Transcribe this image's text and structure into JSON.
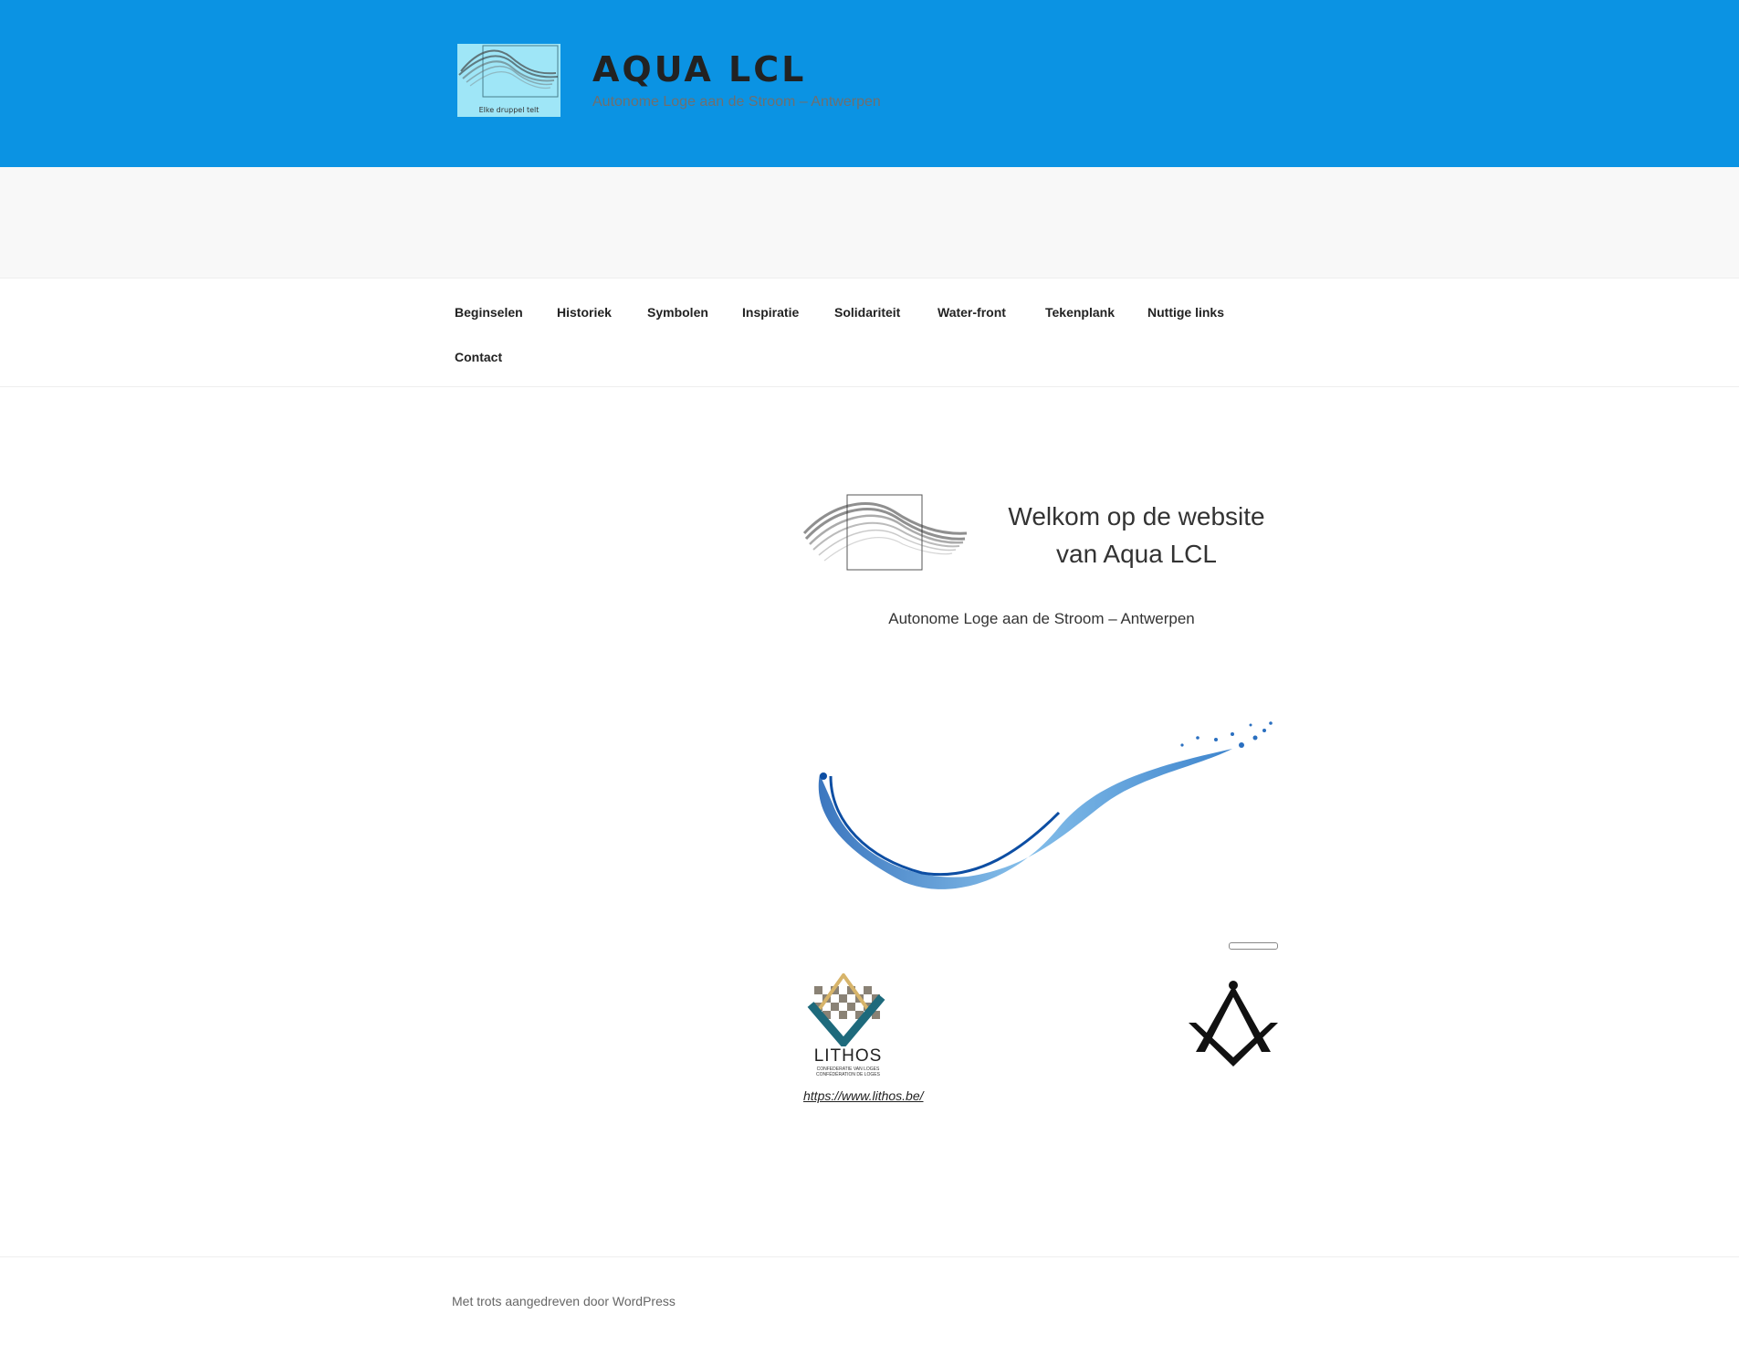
{
  "header": {
    "title": "AQUA LCL",
    "tagline": "Autonome Loge aan de Stroom – Antwerpen",
    "logo_caption": "Elke druppel telt",
    "background_color": "#0b93e3"
  },
  "nav": {
    "items": [
      {
        "label": "Beginselen"
      },
      {
        "label": "Historiek"
      },
      {
        "label": "Symbolen"
      },
      {
        "label": "Inspiratie"
      },
      {
        "label": "Solidariteit"
      },
      {
        "label": "Water-front"
      },
      {
        "label": "Tekenplank"
      },
      {
        "label": "Nuttige links"
      },
      {
        "label": "Contact"
      }
    ]
  },
  "main": {
    "welcome_line1": "Welkom op de website",
    "welcome_line2": "van Aqua LCL",
    "subtitle": "Autonome Loge aan de Stroom – Antwerpen",
    "lithos_logo": {
      "word": "LITHOS",
      "line1": "CONFEDERATIE VAN LOGES",
      "line2": "CONFÉDÉRATION DE LOGES"
    },
    "lithos_link": "https://www.lithos.be/"
  },
  "footer": {
    "credit": "Met trots aangedreven door WordPress"
  },
  "icons": [
    "brush-stroke-logo-icon",
    "water-splash-icon",
    "lithos-logo-icon",
    "square-and-compasses-icon"
  ]
}
